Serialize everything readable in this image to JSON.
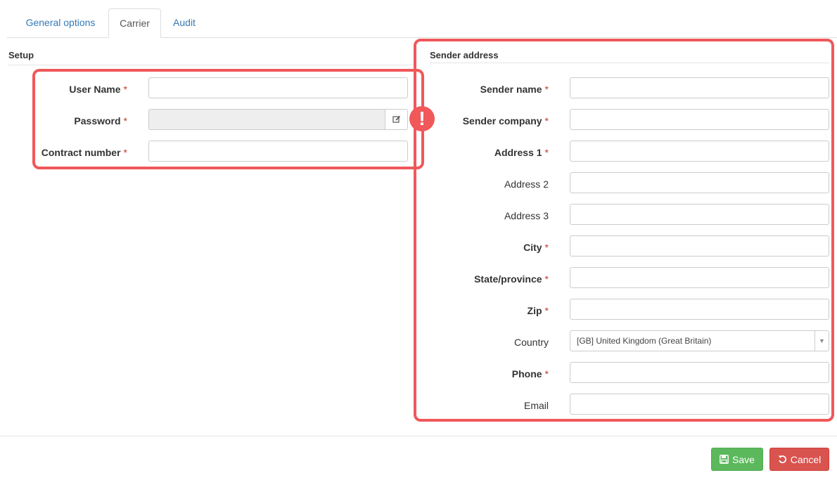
{
  "tabs": [
    {
      "label": "General options",
      "active": false
    },
    {
      "label": "Carrier",
      "active": true
    },
    {
      "label": "Audit",
      "active": false
    }
  ],
  "setup": {
    "title": "Setup",
    "fields": [
      {
        "label": "User Name",
        "required": true,
        "value": ""
      },
      {
        "label": "Password",
        "required": true,
        "value": "",
        "disabled": true
      },
      {
        "label": "Contract number",
        "required": true,
        "value": ""
      }
    ]
  },
  "sender": {
    "title": "Sender address",
    "fields": [
      {
        "label": "Sender name",
        "required": true,
        "value": ""
      },
      {
        "label": "Sender company",
        "required": true,
        "value": ""
      },
      {
        "label": "Address 1",
        "required": true,
        "value": ""
      },
      {
        "label": "Address 2",
        "required": false,
        "value": ""
      },
      {
        "label": "Address 3",
        "required": false,
        "value": ""
      },
      {
        "label": "City",
        "required": true,
        "value": ""
      },
      {
        "label": "State/province",
        "required": true,
        "value": ""
      },
      {
        "label": "Zip",
        "required": true,
        "value": ""
      },
      {
        "label": "Country",
        "required": false,
        "value": "[GB] United Kingdom (Great Britain)"
      },
      {
        "label": "Phone",
        "required": true,
        "value": ""
      },
      {
        "label": "Email",
        "required": false,
        "value": ""
      }
    ]
  },
  "required_marker": "*",
  "alert_glyph": "!",
  "footer": {
    "save_label": "Save",
    "cancel_label": "Cancel"
  },
  "colors": {
    "highlight": "#f0585a",
    "save": "#5cb85c",
    "cancel": "#d9534f",
    "tab_link": "#337ab7"
  }
}
